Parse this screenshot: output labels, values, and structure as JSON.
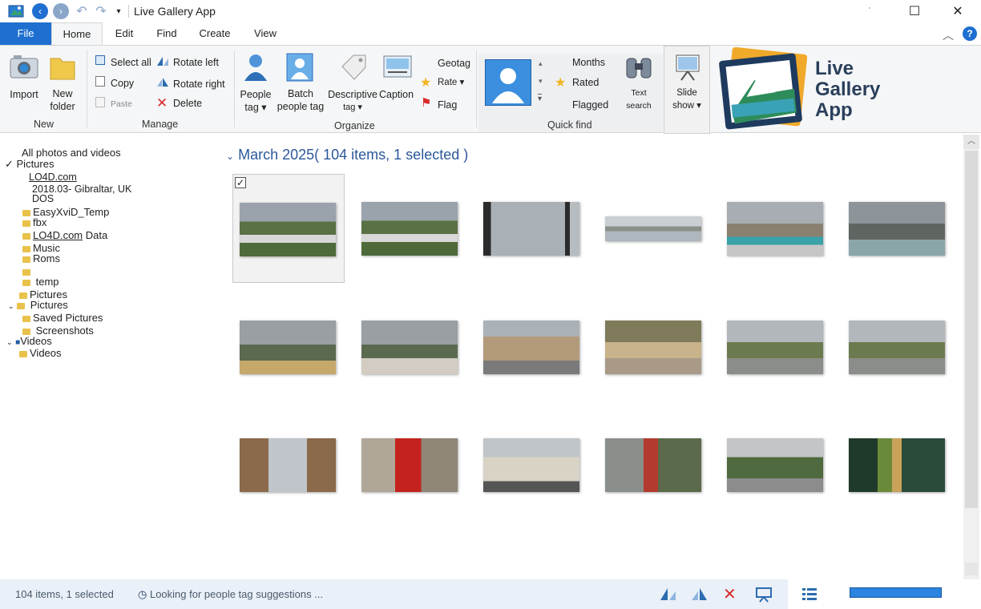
{
  "window": {
    "title": "Live Gallery App",
    "minimize": "ˈ",
    "maximize": "☐",
    "close": "✕"
  },
  "tabs": [
    "File",
    "Home",
    "Edit",
    "Find",
    "Create",
    "View"
  ],
  "ribbon": {
    "new": {
      "import": "Import",
      "new_folder_1": "New",
      "new_folder_2": "folder",
      "group": "New"
    },
    "manage": {
      "select_all": "Select all",
      "copy": "Copy",
      "paste": "Paste",
      "rotate_left": "Rotate left",
      "rotate_right": "Rotate right",
      "delete": "Delete",
      "group": "Manage"
    },
    "organize": {
      "people_tag_1": "People",
      "people_tag_2": "tag",
      "batch_1": "Batch",
      "batch_2": "people tag",
      "descriptive_1": "Descriptive",
      "descriptive_2": "tag",
      "caption": "Caption",
      "geotag": "Geotag",
      "rate": "Rate",
      "flag": "Flag",
      "group": "Organize"
    },
    "quickfind": {
      "months": "Months",
      "rated": "Rated",
      "flagged": "Flagged",
      "text_search_1": "Text",
      "text_search_2": "search",
      "group": "Quick find"
    },
    "slideshow": {
      "label_1": "Slide",
      "label_2": "show"
    },
    "logo": {
      "line1": "Live",
      "line2": "Gallery",
      "line3": "App"
    }
  },
  "sidebar": {
    "items": [
      "All photos and videos",
      "Pictures",
      "LO4D.com",
      "2018.03- Gibraltar, UK",
      "DOS",
      "EasyXviD_Temp",
      "fbx",
      "LO4D.com",
      "Data",
      "Music",
      "Roms",
      "temp",
      "Pictures",
      "Pictures",
      "Saved Pictures",
      "Screenshots",
      "Videos",
      "Videos"
    ]
  },
  "main": {
    "group_header": "March 2025( 104 items, 1 selected )"
  },
  "status": {
    "count": "104 items, 1 selected",
    "message": "Looking for people tag suggestions ...",
    "progress": 1.0
  },
  "colors": {
    "accent": "#1e6fd0",
    "header_text": "#2b579a",
    "status_bg": "#e9f0f8"
  }
}
